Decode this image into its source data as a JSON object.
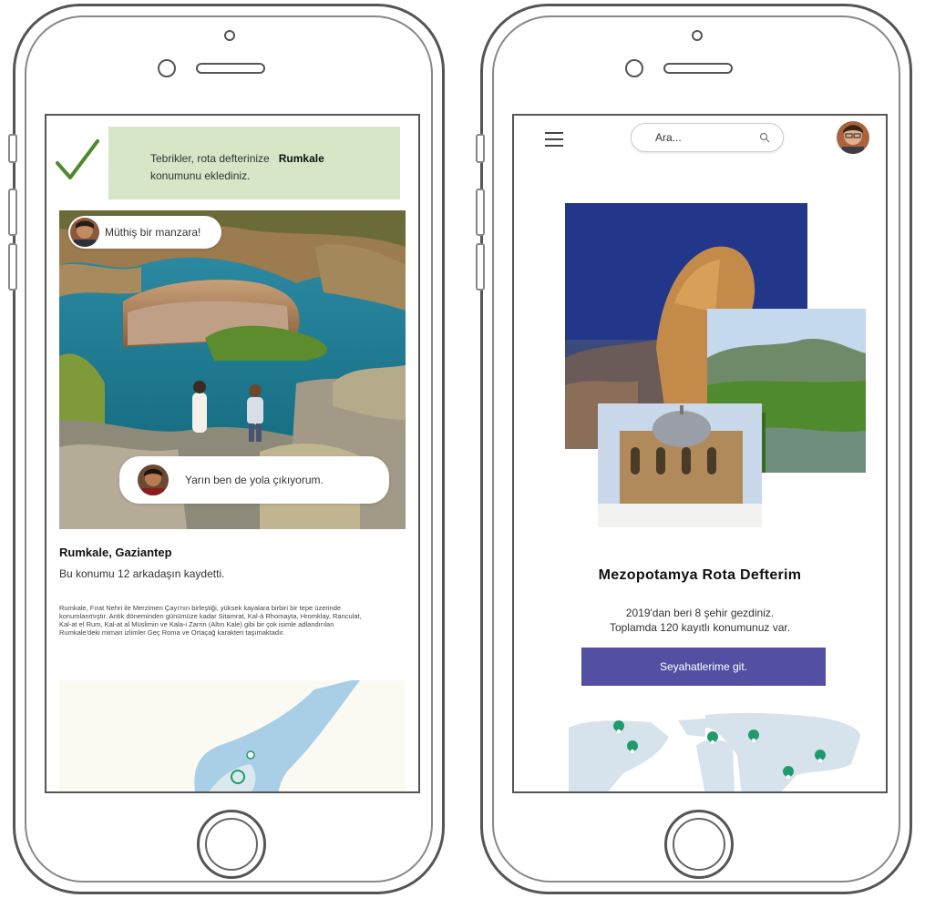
{
  "left_screen": {
    "notification": {
      "text_before": "Tebrikler, rota defterinize",
      "place": "Rumkale",
      "text_after": "konumunu eklediniz."
    },
    "comment_top": "Müthiş bir manzara!",
    "comment_bottom": "Yarın ben de yola çıkıyorum.",
    "place_title": "Rumkale, Gaziantep",
    "place_subtitle": "Bu konumu 12 arkadaşın kaydetti.",
    "description": "Rumkale, Fırat Nehri ile Merzimen Çayı'nın birleştiği, yüksek kayalara birbiri bir tepe üzerinde konumlanmıştır. Antik döneminden günümüze kadar Sitamrat, Kal-à Rhomayta, Hromklay, Ranculat, Kal-at el Rum, Kal-at al Müslimin ve Kala-i Zarrin (Altın Kale) gibi bir çok isimle adlandırılan Rumkale'deki mimari izlimler Geç Roma ve Ortaçağ karakteri taşımaktadır."
  },
  "right_screen": {
    "search": {
      "placeholder": "Ara..."
    },
    "title": "Mezopotamya Rota Defterim",
    "stats_line1": "2019'dan beri 8 şehir gezdiniz.",
    "stats_line2": "Toplamda 120 kayıtlı konumunuz var.",
    "cta_label": "Seyahatlerime git."
  },
  "colors": {
    "banner_bg": "#d6e6c6",
    "check_green": "#4f8a2a",
    "cta_bg": "#534fa3",
    "map_water": "#a9cfe6",
    "map_pin": "#1f9a6a"
  }
}
